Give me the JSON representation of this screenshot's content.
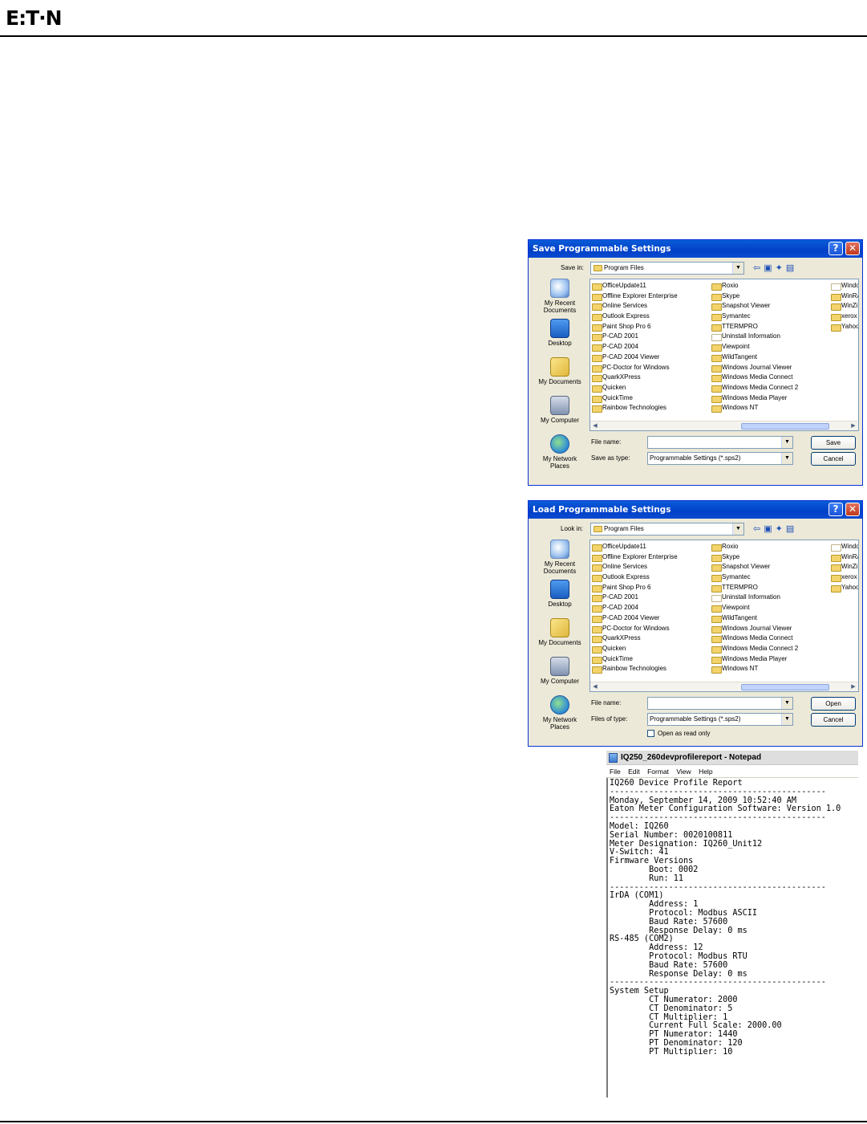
{
  "brand": {
    "logo_text": "E:T·N"
  },
  "save_dialog": {
    "title": "Save Programmable Settings",
    "look_label": "Save in:",
    "location": "Program Files",
    "places": [
      "My Recent Documents",
      "Desktop",
      "My Documents",
      "My Computer",
      "My Network Places"
    ],
    "files_col1": [
      "OfficeUpdate11",
      "Offline Explorer Enterprise",
      "Online Services",
      "Outlook Express",
      "Paint Shop Pro 6",
      "P-CAD 2001",
      "P-CAD 2004",
      "P-CAD 2004 Viewer",
      "PC-Doctor for Windows",
      "QuarkXPress",
      "Quicken",
      "QuickTime",
      "Rainbow Technologies"
    ],
    "files_col2": [
      "Roxio",
      "Skype",
      "Snapshot Viewer",
      "Symantec",
      "TTERMPRO",
      "Uninstall Information",
      "Viewpoint",
      "WildTangent",
      "Windows Journal Viewer",
      "Windows Media Connect",
      "Windows Media Connect 2",
      "Windows Media Player",
      "Windows NT"
    ],
    "files_col3": [
      "Windo",
      "WinRA",
      "WinZip",
      "xerox",
      "Yahoo"
    ],
    "file_name_label": "File name:",
    "file_name_value": "",
    "type_label": "Save as type:",
    "type_value": "Programmable Settings (*.sps2)",
    "primary_button": "Save",
    "cancel_button": "Cancel"
  },
  "load_dialog": {
    "title": "Load Programmable Settings",
    "look_label": "Look in:",
    "location": "Program Files",
    "places": [
      "My Recent Documents",
      "Desktop",
      "My Documents",
      "My Computer",
      "My Network Places"
    ],
    "files_col1": [
      "OfficeUpdate11",
      "Offline Explorer Enterprise",
      "Online Services",
      "Outlook Express",
      "Paint Shop Pro 6",
      "P-CAD 2001",
      "P-CAD 2004",
      "P-CAD 2004 Viewer",
      "PC-Doctor for Windows",
      "QuarkXPress",
      "Quicken",
      "QuickTime",
      "Rainbow Technologies"
    ],
    "files_col2": [
      "Roxio",
      "Skype",
      "Snapshot Viewer",
      "Symantec",
      "TTERMPRO",
      "Uninstall Information",
      "Viewpoint",
      "WildTangent",
      "Windows Journal Viewer",
      "Windows Media Connect",
      "Windows Media Connect 2",
      "Windows Media Player",
      "Windows NT"
    ],
    "files_col3": [
      "Windo",
      "WinRA",
      "WinZip",
      "xerox",
      "Yahoo"
    ],
    "file_name_label": "File name:",
    "file_name_value": "",
    "type_label": "Files of type:",
    "type_value": "Programmable Settings (*.sps2)",
    "primary_button": "Open",
    "cancel_button": "Cancel",
    "readonly_label": "Open as read only"
  },
  "notepad": {
    "title": "IQ250_260devprofilereport - Notepad",
    "menu": [
      "File",
      "Edit",
      "Format",
      "View",
      "Help"
    ],
    "lines": [
      "IQ260 Device Profile Report",
      "--------------------------------------------",
      "Monday, September 14, 2009 10:52:40 AM",
      "Eaton Meter Configuration Software: Version 1.0",
      "--------------------------------------------",
      "Model: IQ260",
      "Serial Number: 0020100811",
      "Meter Designation: IQ260_Unit12",
      "V-Switch: 41",
      "Firmware Versions",
      "        Boot: 0002",
      "        Run: 11",
      "",
      "--------------------------------------------",
      "IrDA (COM1)",
      "        Address: 1",
      "        Protocol: Modbus ASCII",
      "        Baud Rate: 57600",
      "        Response Delay: 0 ms",
      "",
      "RS-485 (COM2)",
      "        Address: 12",
      "        Protocol: Modbus RTU",
      "        Baud Rate: 57600",
      "        Response Delay: 0 ms",
      "",
      "--------------------------------------------",
      "System Setup",
      "        CT Numerator: 2000",
      "        CT Denominator: 5",
      "        CT Multiplier: 1",
      "        Current Full Scale: 2000.00",
      "",
      "        PT Numerator: 1440",
      "        PT Denominator: 120",
      "        PT Multiplier: 10"
    ]
  }
}
